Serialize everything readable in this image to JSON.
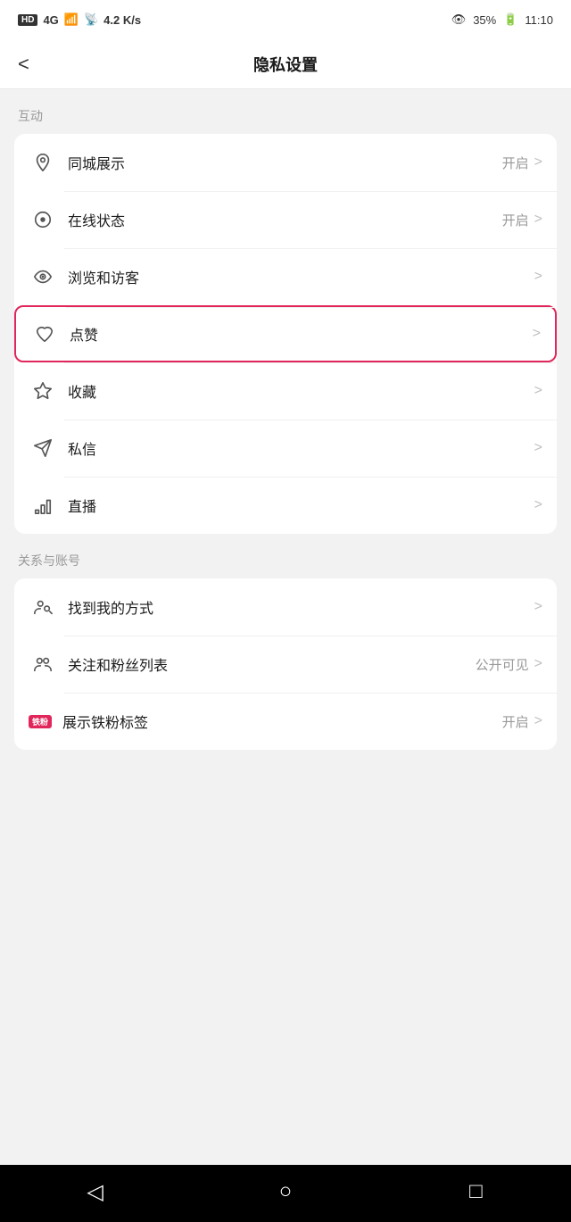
{
  "statusBar": {
    "hd": "HD",
    "signal4g": "4G",
    "networkSpeed": "4.2 K/s",
    "eye": "👁",
    "battery": "35%",
    "time": "11:10"
  },
  "header": {
    "back": "<",
    "title": "隐私设置"
  },
  "section1": {
    "label": "互动",
    "items": [
      {
        "id": "tongcheng",
        "icon": "location",
        "label": "同城展示",
        "value": "开启",
        "arrow": ">"
      },
      {
        "id": "online",
        "icon": "circle-dot",
        "label": "在线状态",
        "value": "开启",
        "arrow": ">"
      },
      {
        "id": "browse",
        "icon": "eye",
        "label": "浏览和访客",
        "value": "",
        "arrow": ">"
      },
      {
        "id": "like",
        "icon": "heart",
        "label": "点赞",
        "value": "",
        "arrow": ">",
        "highlighted": true
      },
      {
        "id": "collect",
        "icon": "star",
        "label": "收藏",
        "value": "",
        "arrow": ">"
      },
      {
        "id": "message",
        "icon": "send",
        "label": "私信",
        "value": "",
        "arrow": ">"
      },
      {
        "id": "live",
        "icon": "bar-chart",
        "label": "直播",
        "value": "",
        "arrow": ">"
      }
    ]
  },
  "section2": {
    "label": "关系与账号",
    "items": [
      {
        "id": "findme",
        "icon": "person-search",
        "label": "找到我的方式",
        "value": "",
        "arrow": ">"
      },
      {
        "id": "follow",
        "icon": "persons",
        "label": "关注和粉丝列表",
        "value": "公开可见",
        "arrow": ">"
      },
      {
        "id": "ironfan",
        "icon": "ironfan",
        "label": "展示铁粉标签",
        "value": "开启",
        "arrow": ">"
      }
    ]
  },
  "bottomNav": {
    "back": "◁",
    "home": "○",
    "square": "□"
  }
}
